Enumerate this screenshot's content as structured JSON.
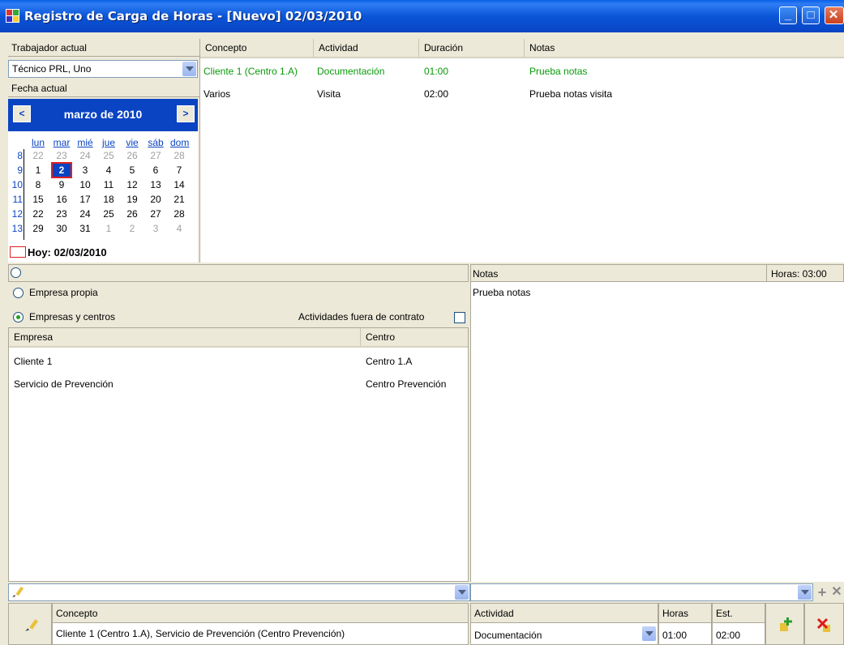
{
  "window": {
    "title": "Registro de Carga de Horas - [Nuevo] 02/03/2010"
  },
  "left": {
    "worker_label": "Trabajador actual",
    "worker_value": "Técnico PRL, Uno",
    "date_label": "Fecha actual"
  },
  "calendar": {
    "month_title": "marzo de 2010",
    "prev": "<",
    "next": ">",
    "day_names": [
      "lun",
      "mar",
      "mié",
      "jue",
      "vie",
      "sáb",
      "dom"
    ],
    "weeks": [
      {
        "wk": "8",
        "days": [
          "22",
          "23",
          "24",
          "25",
          "26",
          "27",
          "28"
        ]
      },
      {
        "wk": "9",
        "days": [
          "1",
          "2",
          "3",
          "4",
          "5",
          "6",
          "7"
        ]
      },
      {
        "wk": "10",
        "days": [
          "8",
          "9",
          "10",
          "11",
          "12",
          "13",
          "14"
        ]
      },
      {
        "wk": "11",
        "days": [
          "15",
          "16",
          "17",
          "18",
          "19",
          "20",
          "21"
        ]
      },
      {
        "wk": "12",
        "days": [
          "22",
          "23",
          "24",
          "25",
          "26",
          "27",
          "28"
        ]
      },
      {
        "wk": "13",
        "days": [
          "29",
          "30",
          "31",
          "1",
          "2",
          "3",
          "4"
        ]
      }
    ],
    "today": "Hoy: 02/03/2010",
    "selected": "2"
  },
  "entries": {
    "columns": [
      "Concepto",
      "Actividad",
      "Duración",
      "Notas"
    ],
    "rows": [
      {
        "concepto": "Cliente 1 (Centro 1.A)",
        "actividad": "Documentación",
        "duracion": "01:00",
        "notas": "Prueba notas"
      },
      {
        "concepto": "Varios",
        "actividad": "Visita",
        "duracion": "02:00",
        "notas": "Prueba notas visita"
      }
    ]
  },
  "options": {
    "radio1": "Empresa propia",
    "radio2": "Empresas y centros",
    "check_label": "Actividades fuera de contrato"
  },
  "companies": {
    "columns": [
      "Empresa",
      "Centro"
    ],
    "rows": [
      {
        "empresa": "Cliente 1",
        "centro": "Centro 1.A"
      },
      {
        "empresa": "Servicio de Prevención",
        "centro": "Centro Prevención"
      }
    ]
  },
  "notes": {
    "header": "Notas",
    "hours": "Horas: 03:00",
    "text": "Prueba notas"
  },
  "bottom": {
    "concepto_header": "Concepto",
    "concepto_value": "Cliente 1 (Centro 1.A), Servicio de Prevención (Centro Prevención)",
    "actividad_header": "Actividad",
    "actividad_value": "Documentación",
    "horas_header": "Horas",
    "horas_value": "01:00",
    "est_header": "Est.",
    "est_value": "02:00"
  },
  "colors": {
    "accent": "#0a44c3",
    "entry_highlight": "#0a9a0a",
    "selected_day": "#0a44c3",
    "today_border": "#e02020"
  }
}
